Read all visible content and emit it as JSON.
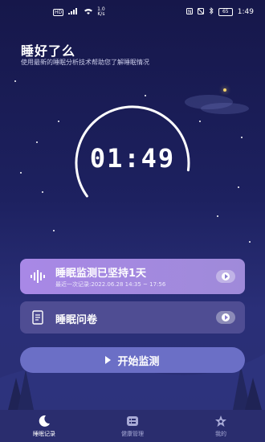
{
  "status_bar": {
    "network_label": "HD",
    "signal": "4G",
    "speed_value": "1.0",
    "speed_unit": "K/s",
    "battery": "65",
    "time": "1:49"
  },
  "header": {
    "title": "睡好了么",
    "subtitle": "使用最新的睡眠分析技术帮助您了解睡眠情况"
  },
  "timer": {
    "value": "01:49",
    "progress_fraction": 0.62
  },
  "record_card": {
    "title": "睡眠监测已坚持1天",
    "subtitle": "最近一次记录:2022.06.28 14:35 ~ 17:56"
  },
  "survey_card": {
    "title": "睡眠问卷"
  },
  "start_button": {
    "label": "开始监测"
  },
  "tabs": [
    {
      "label": "睡眠记录",
      "icon": "moon-icon",
      "active": true
    },
    {
      "label": "健康管理",
      "icon": "list-icon",
      "active": false
    },
    {
      "label": "我的",
      "icon": "person-icon",
      "active": false
    }
  ],
  "colors": {
    "background_top": "#16174a",
    "record_card": "#a888e6",
    "start_button": "#6b6fc6",
    "moon_accent": "#f4d36b"
  }
}
